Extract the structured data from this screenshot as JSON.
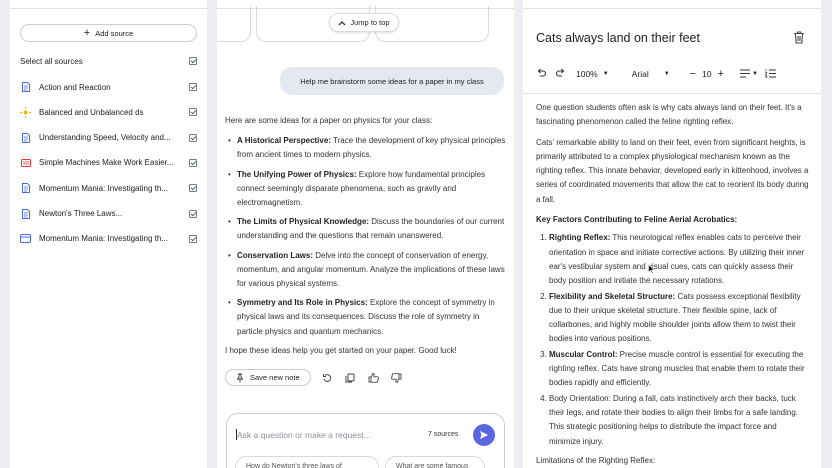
{
  "left": {
    "add_source": "Add source",
    "select_all": "Select all sources",
    "sources": [
      {
        "icon": "doc-icon",
        "color": "#4a6ee0",
        "label": "Action and Reaction"
      },
      {
        "icon": "sun-icon",
        "color": "#f4b400",
        "label": "Balanced and Unbalanced ds"
      },
      {
        "icon": "doc-icon",
        "color": "#4a6ee0",
        "label": "Understanding Speed, Velocity and..."
      },
      {
        "icon": "youtube-icon",
        "color": "#e53935",
        "label": "Simple Machines Make Work Easier..."
      },
      {
        "icon": "doc-icon",
        "color": "#4a6ee0",
        "label": "Momentum Mania: Investigating th..."
      },
      {
        "icon": "doc-icon",
        "color": "#4a6ee0",
        "label": "Newton's Three Laws..."
      },
      {
        "icon": "slides-icon",
        "color": "#4a6ee0",
        "label": "Momentum Mania: Investigating th..."
      }
    ]
  },
  "mid": {
    "jump": "Jump to top",
    "user_msg": "Help me brainstorm some ideas for a paper in my class",
    "intro": "Here are some ideas for a paper on physics for your class:",
    "ideas": [
      {
        "title": "A Historical Perspective:",
        "text": " Trace the development of key physical principles from ancient times to modern physics."
      },
      {
        "title": "The Unifying Power of Physics:",
        "text": " Explore how fundamental principles connect seemingly disparate phenomena, such as gravity and electromagnetism."
      },
      {
        "title": "The Limits of Physical Knowledge:",
        "text": " Discuss the boundaries of our current understanding and the questions that remain unanswered."
      },
      {
        "title": "Conservation Laws:",
        "text": " Delve into the concept of conservation of energy, momentum, and angular momentum. Analyze the implications of these laws for various physical systems."
      },
      {
        "title": "Symmetry and Its Role in Physics:",
        "text": " Explore the concept of symmetry in physical laws and its consequences. Discuss the role of symmetry in particle physics and quantum mechanics."
      }
    ],
    "closing": "I hope these ideas help you get started on your paper. Good luck!",
    "save_note": "Save new note",
    "placeholder": "Ask a question or make a request...",
    "sources_count": "7 sources",
    "suggestions": [
      "How do Newton's three laws of",
      "What are some famous"
    ]
  },
  "right": {
    "title": "Cats always land on their feet",
    "toolbar": {
      "zoom": "100%",
      "font": "Arial",
      "size": "10"
    },
    "p1": "One question students often ask is why cats always land on their feet. It's a fascinating phenomenon called the feline righting reflex.",
    "p2": "Cats' remarkable ability to land on their feet, even from significant heights, is primarily attributed to a complex physiological mechanism known as the righting reflex. This innate behavior, developed early in kittenhood, involves a series of coordinated movements that allow the cat to reorient its body during a fall.",
    "heading": "Key Factors Contributing to Feline Aerial Acrobatics:",
    "factors": [
      {
        "title": "Righting Reflex:",
        "text": " This neurological reflex enables cats to perceive their orientation in space and initiate corrective actions. By utilizing their inner ear's vestibular system and visual cues, cats can quickly assess their body position and initiate the necessary rotations."
      },
      {
        "title": "Flexibility and Skeletal Structure:",
        "text": " Cats possess exceptional flexibility due to their unique skeletal structure. Their flexible spine, lack of collarbones, and highly mobile shoulder joints allow them to twist their bodies into various positions."
      },
      {
        "title": "Muscular Control:",
        "text": " Precise muscle control is essential for executing the righting reflex. Cats have strong muscles that enable them to rotate their bodies rapidly and efficiently."
      },
      {
        "title": "",
        "text": "Body Orientation: During a fall, cats instinctively arch their backs, tuck their legs, and rotate their bodies to align their limbs for a safe landing. This strategic positioning helps to distribute the impact force and minimize injury."
      }
    ],
    "limits": "Limitations of the Righting Reflex:"
  }
}
